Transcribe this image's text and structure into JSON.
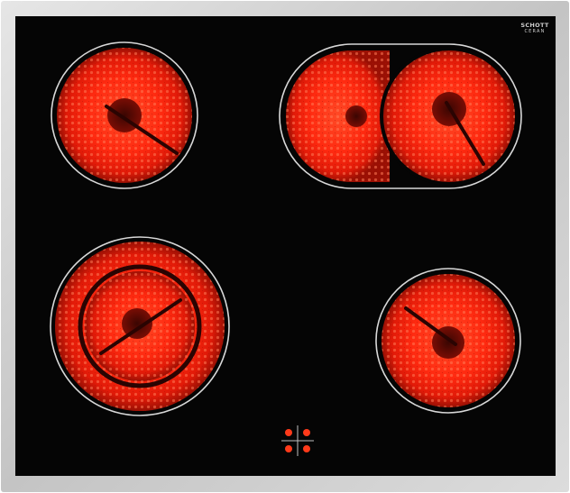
{
  "brand": {
    "line1": "SCHOTT",
    "line2": "CERAN"
  },
  "colors": {
    "frame": "#c9c9c9",
    "glass": "#050505",
    "element_glow": "#ff2a10",
    "element_dark": "#7a0d04",
    "control_glow": "#ff3a1a"
  },
  "zones": [
    {
      "name": "top-left",
      "type": "single",
      "state": "on"
    },
    {
      "name": "top-right",
      "type": "oval-extension",
      "state": "on"
    },
    {
      "name": "bottom-left",
      "type": "dual-ring",
      "state": "on"
    },
    {
      "name": "bottom-right",
      "type": "single",
      "state": "on"
    }
  ],
  "controls": {
    "type": "touch-cross",
    "dots": 4
  }
}
